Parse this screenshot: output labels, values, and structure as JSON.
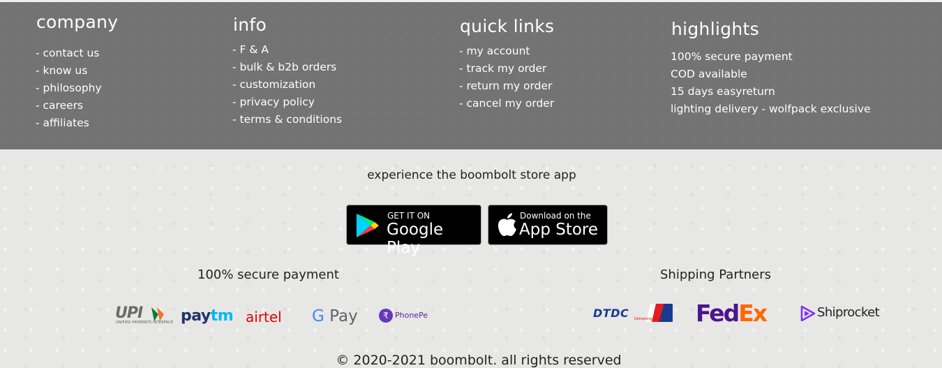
{
  "columns": {
    "company": {
      "title": "company",
      "items": [
        "- contact us",
        "- know us",
        "- philosophy",
        "- careers",
        "- affiliates"
      ]
    },
    "info": {
      "title": "info",
      "items": [
        "- F & A",
        "- bulk & b2b orders",
        "- customization",
        "- privacy policy",
        "- terms & conditions"
      ]
    },
    "quick_links": {
      "title": "quick links",
      "items": [
        "- my account",
        "- track my order",
        "- return my order",
        "- cancel my order"
      ]
    },
    "highlights": {
      "title": "highlights",
      "items": [
        "100% secure payment",
        "COD available",
        "15 days easyreturn",
        "lighting delivery - wolfpack exclusive"
      ]
    }
  },
  "app": {
    "title": "experience the boombolt store app",
    "google_play": {
      "small": "GET IT ON",
      "big": "Google Play"
    },
    "app_store": {
      "small": "Download on the",
      "big": "App Store"
    }
  },
  "payment": {
    "title": "100% secure payment",
    "upi": {
      "name": "UPI",
      "sub": "UNIFIED PAYMENTS INTERFACE"
    },
    "paytm": {
      "part1": "pay",
      "part2": "tm"
    },
    "airtel": "airtel",
    "gpay": {
      "g": "G",
      "pay": "Pay"
    },
    "phonepe": "PhonePe"
  },
  "shipping": {
    "title": "Shipping Partners",
    "dtdc": {
      "name": "DTDC",
      "tagline": "Delivering Value"
    },
    "fedex": {
      "fed": "Fed",
      "ex": "Ex"
    },
    "shiprocket": "Shiprocket"
  },
  "copyright": "© 2020-2021 boombolt. all rights reserved",
  "colors": {
    "footer_bg": "#737373",
    "page_bg": "#e7e7e5",
    "paytm_dark": "#20336b",
    "paytm_light": "#00b9f1",
    "airtel": "#e40000",
    "fedex_purple": "#4d148c",
    "fedex_orange": "#ff6600",
    "phonepe": "#6739b7"
  }
}
